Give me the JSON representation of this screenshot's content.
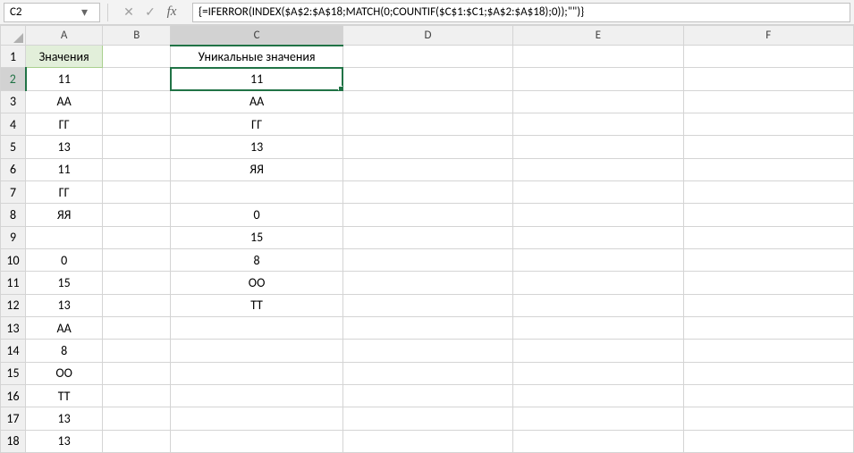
{
  "formula_bar": {
    "cell_ref": "C2",
    "formula": "{=IFERROR(INDEX($A$2:$A$18;MATCH(0;COUNTIF($C$1:$C1;$A$2:$A$18);0));\"\")}",
    "cancel_glyph": "✕",
    "enter_glyph": "✓",
    "fx_label": "fx",
    "dropdown_glyph": "▾"
  },
  "columns": [
    "A",
    "B",
    "C",
    "D",
    "E",
    "F"
  ],
  "row_count": 18,
  "active_cell": {
    "col": "C",
    "row": 2
  },
  "headers": {
    "A1": "Значения",
    "C1": "Уникальные значения"
  },
  "data": {
    "A": {
      "2": "11",
      "3": "АА",
      "4": "ГГ",
      "5": "13",
      "6": "11",
      "7": "ГГ",
      "8": "ЯЯ",
      "9": "",
      "10": "0",
      "11": "15",
      "12": "13",
      "13": "АА",
      "14": "8",
      "15": "ОО",
      "16": "ТТ",
      "17": "13",
      "18": "13"
    },
    "C": {
      "2": "11",
      "3": "АА",
      "4": "ГГ",
      "5": "13",
      "6": "ЯЯ",
      "7": "",
      "8": "0",
      "9": "15",
      "10": "8",
      "11": "ОО",
      "12": "ТТ"
    }
  },
  "chart_data": {
    "type": "table",
    "title": "",
    "columns": [
      "Значения",
      "Уникальные значения"
    ],
    "rows": [
      [
        "11",
        "11"
      ],
      [
        "АА",
        "АА"
      ],
      [
        "ГГ",
        "ГГ"
      ],
      [
        "13",
        "13"
      ],
      [
        "11",
        "ЯЯ"
      ],
      [
        "ГГ",
        ""
      ],
      [
        "ЯЯ",
        "0"
      ],
      [
        "",
        "15"
      ],
      [
        "0",
        "8"
      ],
      [
        "15",
        "ОО"
      ],
      [
        "13",
        "ТТ"
      ],
      [
        "АА",
        ""
      ],
      [
        "8",
        ""
      ],
      [
        "ОО",
        ""
      ],
      [
        "ТТ",
        ""
      ],
      [
        "13",
        ""
      ],
      [
        "13",
        ""
      ]
    ]
  }
}
